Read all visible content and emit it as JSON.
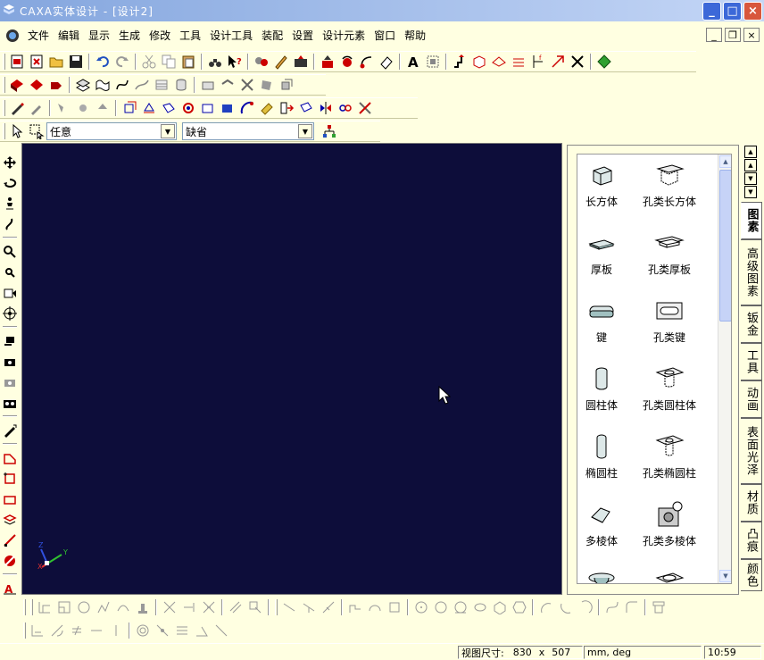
{
  "window": {
    "title": "CAXA实体设计 - [设计2]"
  },
  "menu": [
    "文件",
    "编辑",
    "显示",
    "生成",
    "修改",
    "工具",
    "设计工具",
    "装配",
    "设置",
    "设计元素",
    "窗口",
    "帮助"
  ],
  "selector": {
    "filter": "任意",
    "style": "缺省"
  },
  "catalog_items": [
    {
      "label": "长方体",
      "icon": "block-icon"
    },
    {
      "label": "孔类长方体",
      "icon": "hole-block-icon"
    },
    {
      "label": "厚板",
      "icon": "plate-icon"
    },
    {
      "label": "孔类厚板",
      "icon": "hole-plate-icon"
    },
    {
      "label": "键",
      "icon": "key-icon"
    },
    {
      "label": "孔类键",
      "icon": "hole-key-icon"
    },
    {
      "label": "圆柱体",
      "icon": "cylinder-icon"
    },
    {
      "label": "孔类圆柱体",
      "icon": "hole-cylinder-icon"
    },
    {
      "label": "椭圆柱",
      "icon": "elliptic-cylinder-icon"
    },
    {
      "label": "孔类椭圆柱",
      "icon": "hole-elliptic-cylinder-icon"
    },
    {
      "label": "多棱体",
      "icon": "polygon-prism-icon"
    },
    {
      "label": "孔类多棱体",
      "icon": "hole-polygon-prism-icon"
    }
  ],
  "tabs": [
    "图素",
    "高级图素",
    "钣金",
    "工具",
    "动画",
    "表面光泽",
    "材质",
    "凸痕",
    "颜色"
  ],
  "status": {
    "view_label": "视图尺寸:",
    "view_width": "830",
    "view_x": "x",
    "view_height": "507",
    "units": "mm, deg",
    "time": "10:59"
  },
  "colors": {
    "viewport": "#0D0D3A",
    "workspace": "#FFFFE1",
    "title_start": "#84A6DE"
  }
}
